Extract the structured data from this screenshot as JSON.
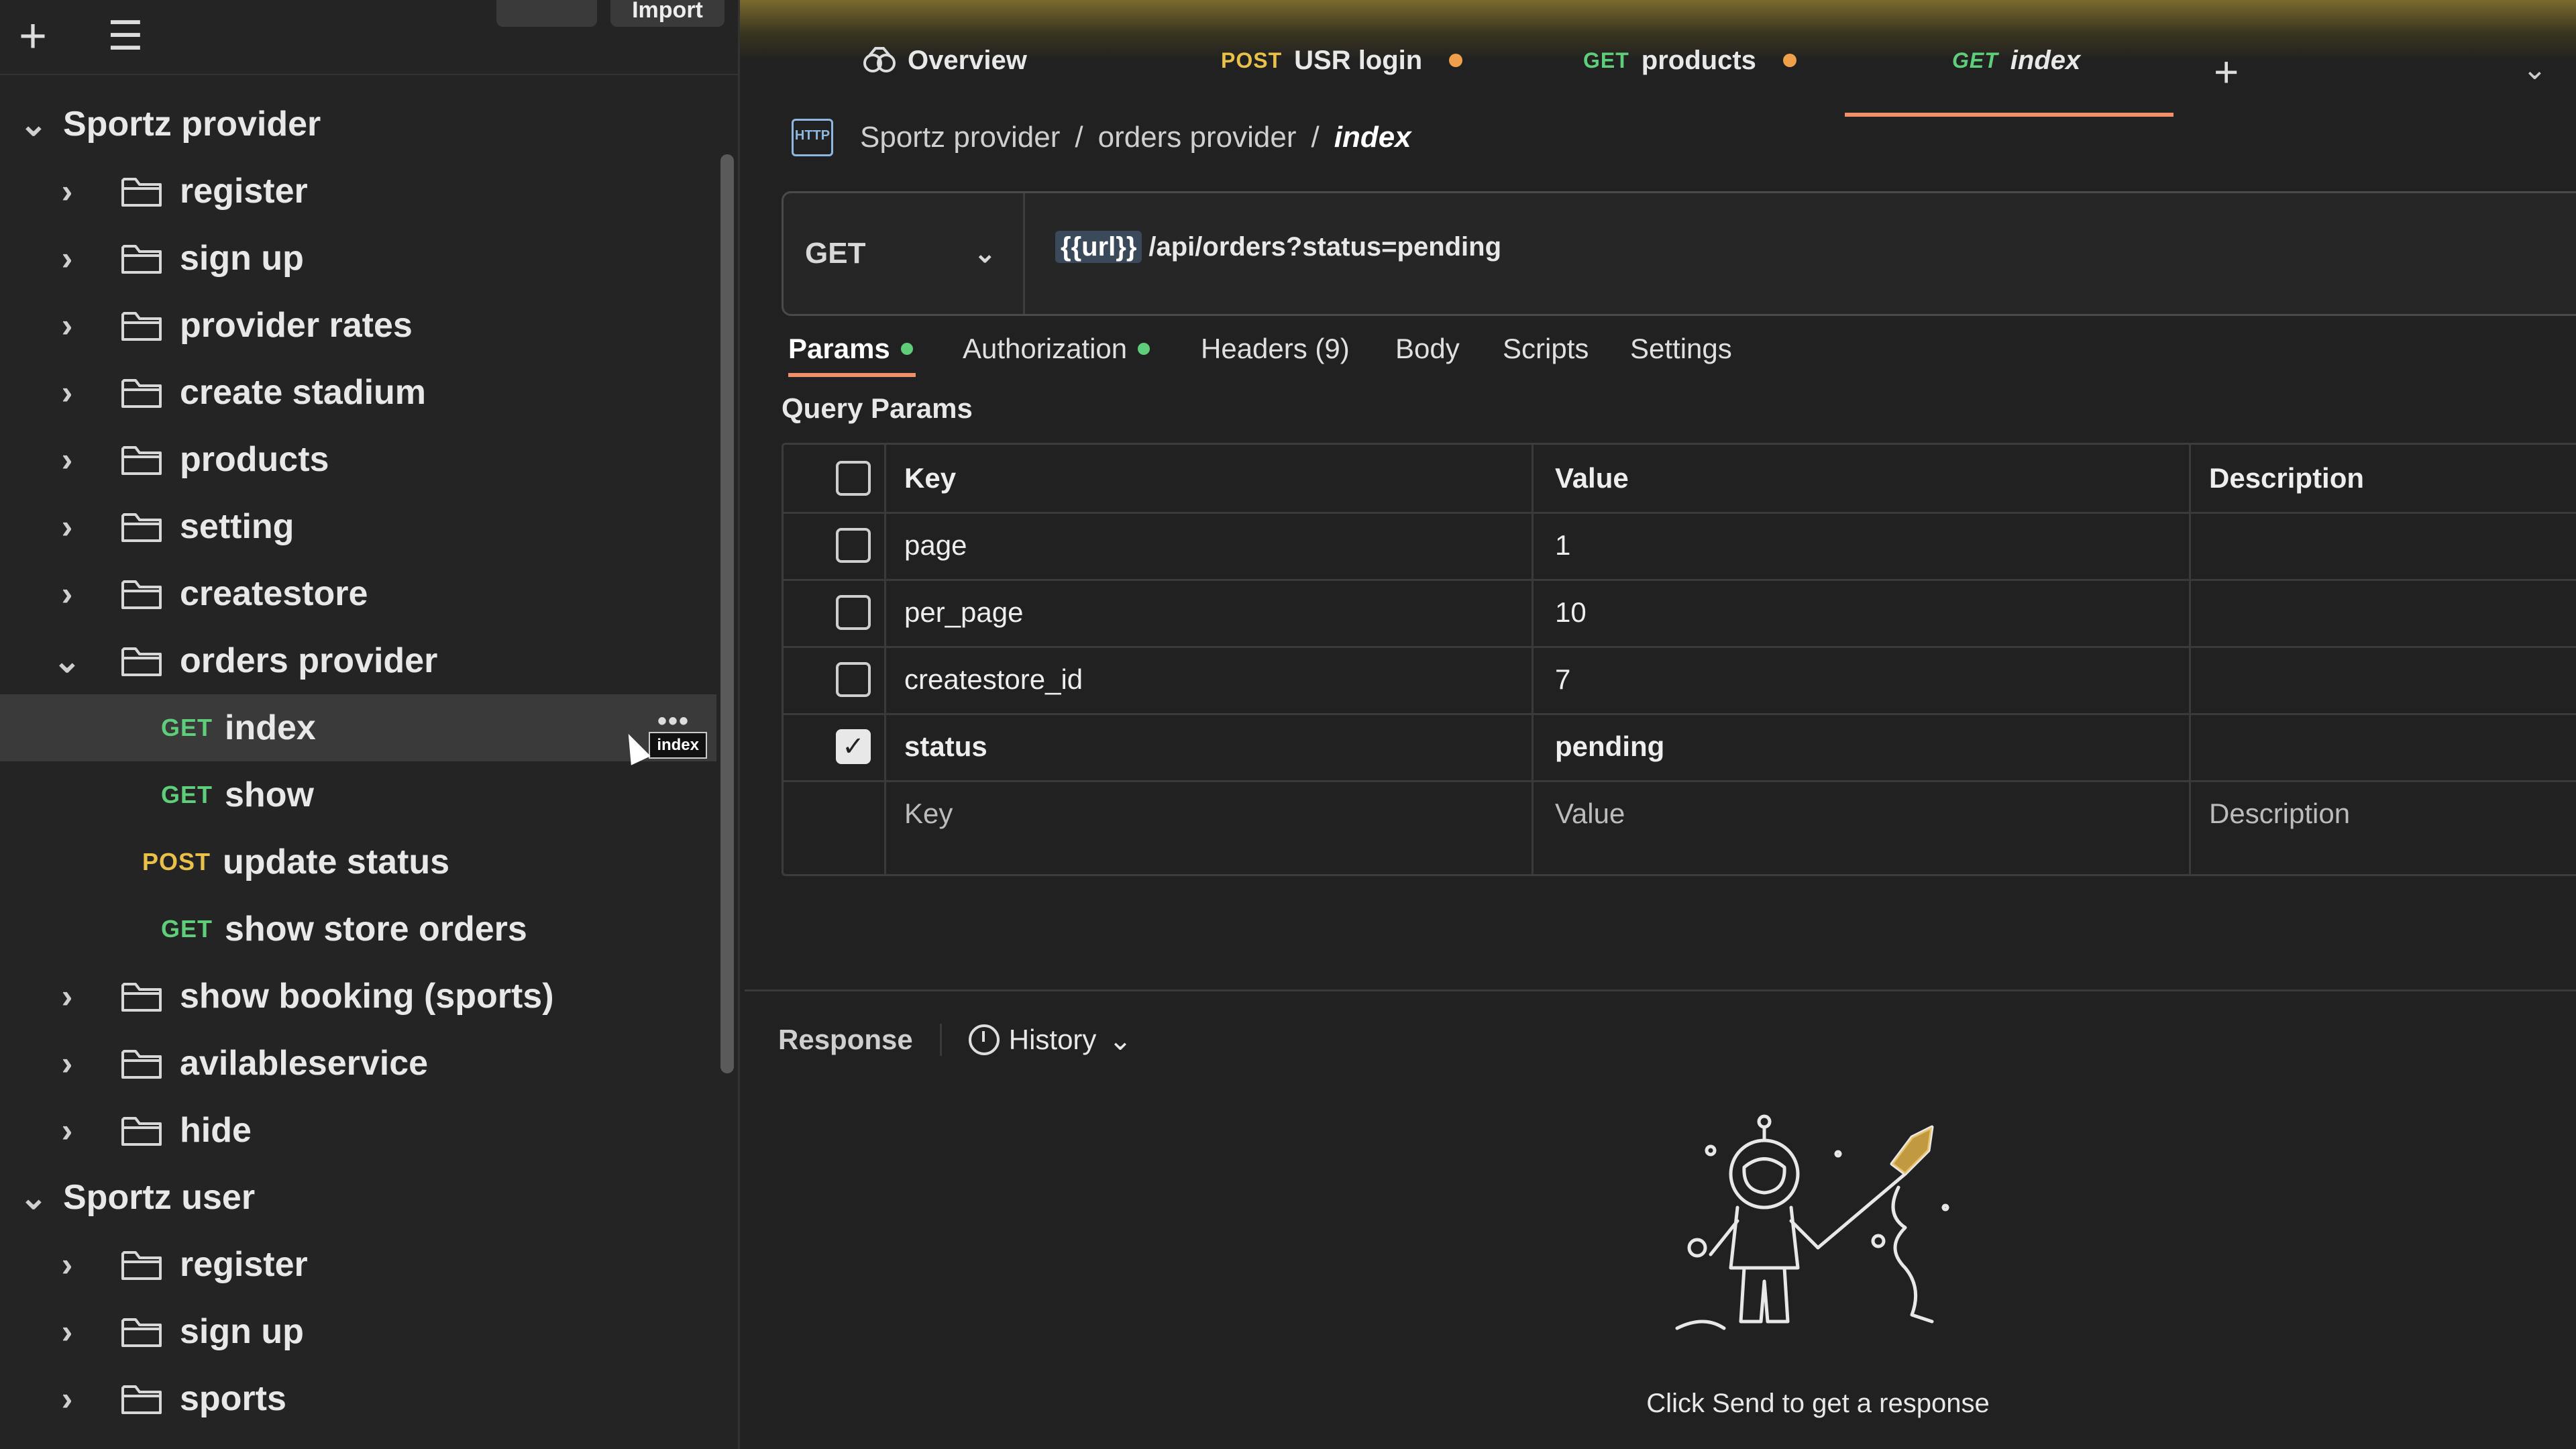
{
  "sidebar": {
    "toolbar": {
      "add_icon": "plus-icon",
      "filter_icon": "filter-icon",
      "import_label": "Import"
    },
    "collections": [
      {
        "name": "Sportz provider",
        "items": [
          {
            "type": "folder",
            "label": "register"
          },
          {
            "type": "folder",
            "label": "sign up"
          },
          {
            "type": "folder",
            "label": "provider rates"
          },
          {
            "type": "folder",
            "label": "create stadium"
          },
          {
            "type": "folder",
            "label": "products"
          },
          {
            "type": "folder",
            "label": "setting"
          },
          {
            "type": "folder",
            "label": "createstore"
          },
          {
            "type": "folder",
            "label": "orders provider",
            "expanded": true
          },
          {
            "type": "request",
            "method": "GET",
            "label": "index",
            "selected": true,
            "tooltip": "index",
            "more": "•••"
          },
          {
            "type": "request",
            "method": "GET",
            "label": "show"
          },
          {
            "type": "request",
            "method": "POST",
            "label": "update status"
          },
          {
            "type": "request",
            "method": "GET",
            "label": "show store orders"
          },
          {
            "type": "folder",
            "label": "show booking (sports)"
          },
          {
            "type": "folder",
            "label": "avilableservice"
          },
          {
            "type": "folder",
            "label": "hide"
          }
        ]
      },
      {
        "name": "Sportz user",
        "items": [
          {
            "type": "folder",
            "label": "register"
          },
          {
            "type": "folder",
            "label": "sign up"
          },
          {
            "type": "folder",
            "label": "sports"
          }
        ]
      }
    ]
  },
  "tabs": [
    {
      "label": "Overview",
      "icon": "overview-icon"
    },
    {
      "method": "POST",
      "label": "USR login",
      "unsaved": true
    },
    {
      "method": "GET",
      "label": "products",
      "unsaved": true
    },
    {
      "method": "GET",
      "label": "index",
      "active": true
    }
  ],
  "breadcrumb": {
    "icon": "HTTP",
    "parts": [
      "Sportz provider",
      "orders provider",
      "index"
    ]
  },
  "request": {
    "method": "GET",
    "url_variable": "{{url}}",
    "url_path": "/api/orders?status=pending"
  },
  "request_tabs": [
    {
      "label": "Params",
      "active": true,
      "dot": true
    },
    {
      "label": "Authorization",
      "dot": true
    },
    {
      "label": "Headers (9)"
    },
    {
      "label": "Body"
    },
    {
      "label": "Scripts"
    },
    {
      "label": "Settings"
    }
  ],
  "query_params": {
    "title": "Query Params",
    "headers": {
      "key": "Key",
      "value": "Value",
      "description": "Description"
    },
    "rows": [
      {
        "key": "page",
        "value": "1",
        "checked": false
      },
      {
        "key": "per_page",
        "value": "10",
        "checked": false
      },
      {
        "key": "createstore_id",
        "value": "7",
        "checked": false
      },
      {
        "key": "status",
        "value": "pending",
        "checked": true
      }
    ],
    "placeholder": {
      "key": "Key",
      "value": "Value",
      "description": "Description"
    }
  },
  "response": {
    "label": "Response",
    "history_label": "History",
    "empty_message": "Click Send to get a response"
  },
  "colors": {
    "get": "#5fce7a",
    "post": "#e8c04a",
    "accent": "#f08f6a",
    "unsaved_dot": "#f0a04a"
  }
}
